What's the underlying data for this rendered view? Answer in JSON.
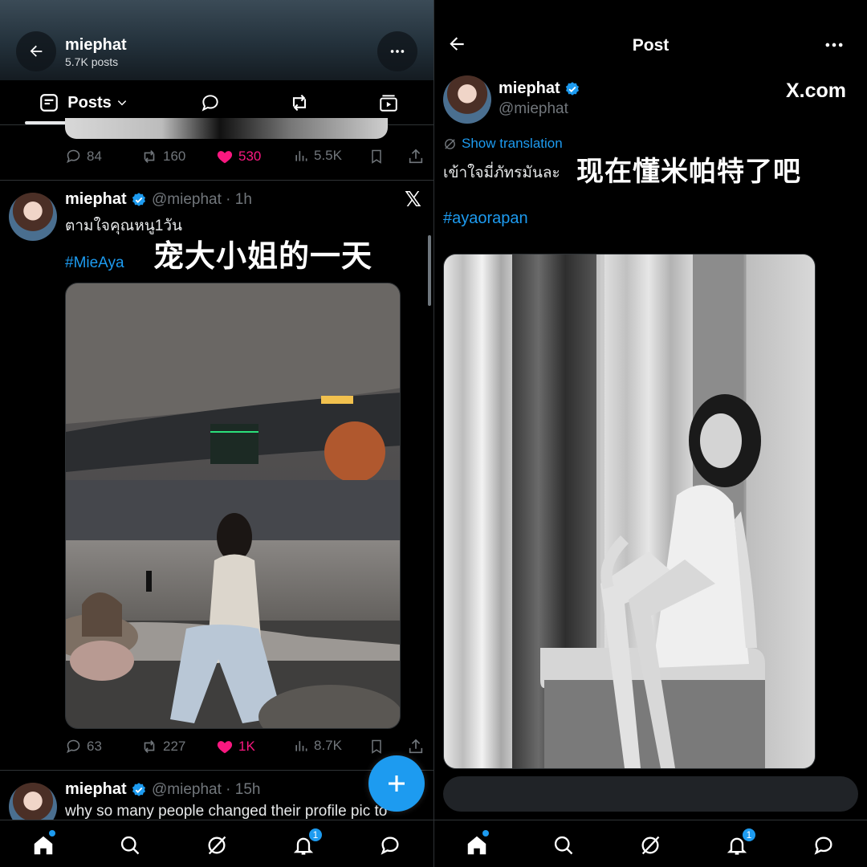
{
  "left": {
    "header": {
      "name": "miephat",
      "post_count": "5.7K posts"
    },
    "tabs": {
      "posts_label": "Posts"
    },
    "prev_post_actions": {
      "replies": "84",
      "reposts": "160",
      "likes": "530",
      "views": "5.5K"
    },
    "post1": {
      "display_name": "miephat",
      "handle_time": "@miephat · 1h",
      "text": "ตามใจคุณหนู1วัน",
      "overlay_caption": "宠大小姐的一天",
      "hashtag": "#MieAya",
      "actions": {
        "replies": "63",
        "reposts": "227",
        "likes": "1K",
        "views": "8.7K"
      }
    },
    "post2": {
      "display_name": "miephat",
      "handle_time": "@miephat · 15h",
      "text": "why so many people changed their profile pic to"
    },
    "nav": {
      "notifications_badge": "1"
    }
  },
  "right": {
    "header": {
      "title": "Post"
    },
    "author": {
      "display_name": "miephat",
      "handle": "@miephat"
    },
    "watermark": "X.com",
    "show_translation": "Show translation",
    "text": "เข้าใจมี่ภัทรมันละ",
    "overlay_caption": "现在懂米帕特了吧",
    "hashtag": "#ayaorapan",
    "nav": {
      "notifications_badge": "1"
    }
  },
  "colors": {
    "accent": "#1d9bf0",
    "like": "#f91880",
    "muted": "#71767b",
    "background": "#000000"
  }
}
